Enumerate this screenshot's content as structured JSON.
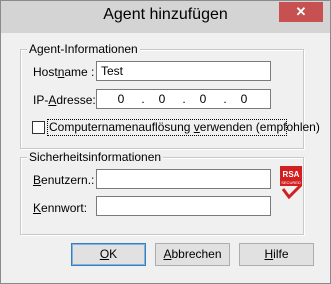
{
  "window": {
    "title": "Agent hinzufügen",
    "close_glyph": "✕"
  },
  "agent_info": {
    "legend": "Agent-Informationen",
    "hostname_label": [
      "Host",
      "n",
      "ame :"
    ],
    "hostname_value": "Test",
    "ip_label": [
      "IP-",
      "A",
      "dresse:"
    ],
    "ip_octets": [
      "0",
      "0",
      "0",
      "0"
    ],
    "ip_separator": ".",
    "checkbox_label": [
      "Computernamenauflösung ",
      "v",
      "erwenden (empfohlen)"
    ],
    "checkbox_checked": false
  },
  "security_info": {
    "legend": "Sicherheitsinformationen",
    "username_label": [
      "",
      "B",
      "enutzern.:"
    ],
    "username_value": "",
    "password_label": [
      "",
      "K",
      "ennwort:"
    ],
    "password_value": "",
    "logo": {
      "text": "RSA",
      "subtext": "SECURED",
      "icon": "rsa-secured-logo",
      "red": "#d21f1f"
    }
  },
  "buttons": {
    "ok": [
      "",
      "O",
      "K"
    ],
    "cancel": [
      "",
      "A",
      "bbrechen"
    ],
    "help": [
      "",
      "H",
      "ilfe"
    ]
  }
}
